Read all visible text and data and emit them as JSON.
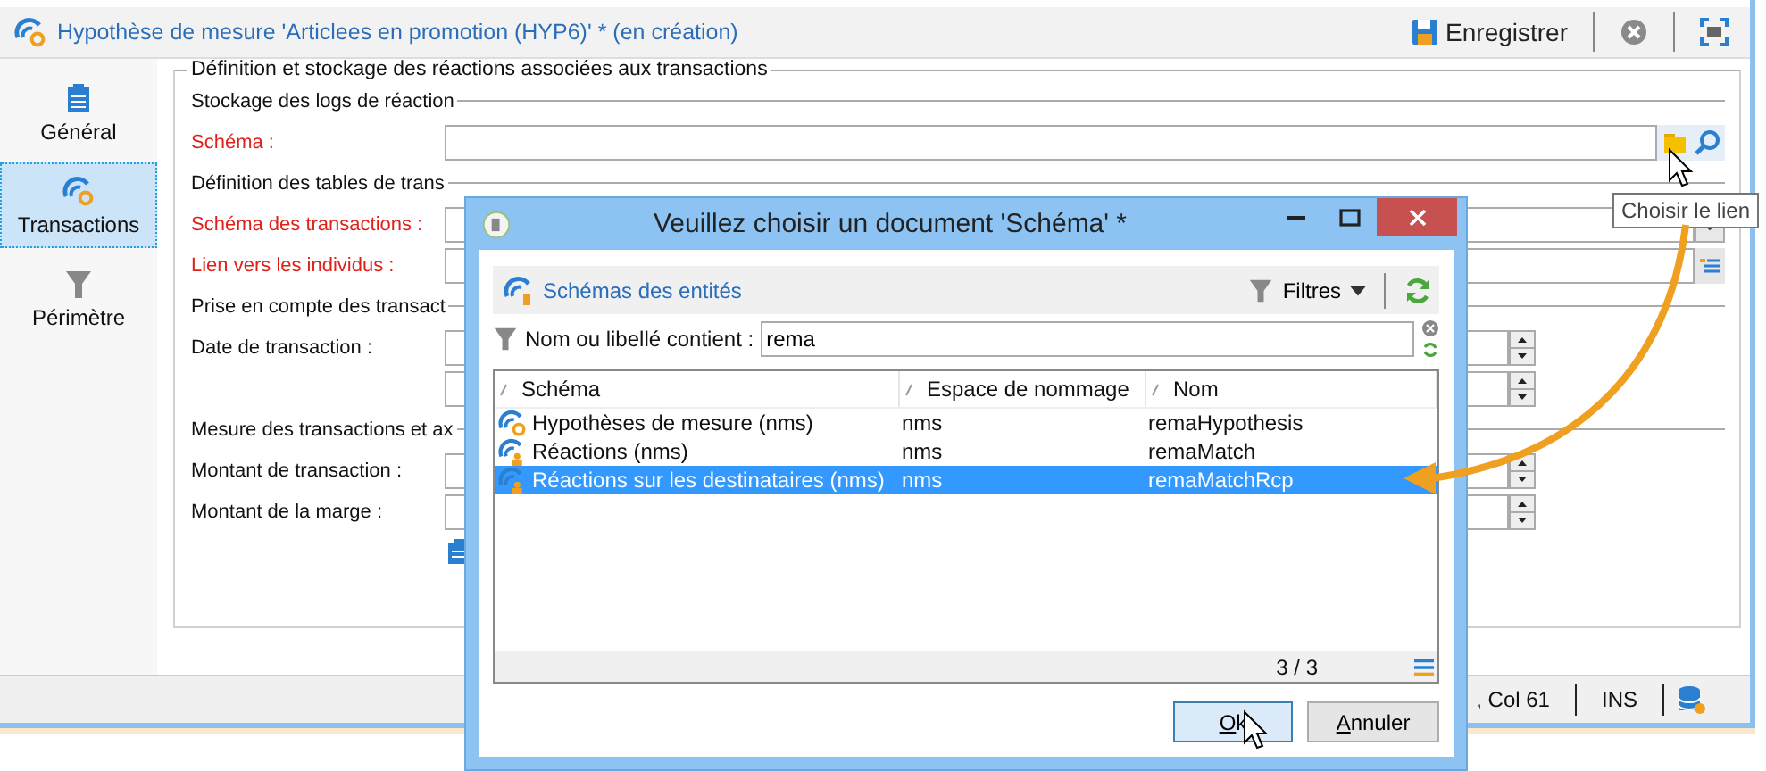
{
  "window": {
    "title": "Hypothèse de mesure 'Articlees en promotion (HYP6)' * (en création)",
    "save_label": "Enregistrer"
  },
  "sidebar": {
    "items": [
      {
        "kind": "general",
        "label": "Général",
        "selected": false
      },
      {
        "kind": "transactions",
        "label": "Transactions",
        "selected": true
      },
      {
        "kind": "perimeter",
        "label": "Périmètre",
        "selected": false
      }
    ]
  },
  "form": {
    "title": "Définition et stockage des réactions associées aux transactions",
    "rows": [
      {
        "kind": "section",
        "label": "Stockage des logs de réaction"
      },
      {
        "kind": "link",
        "label": "Schéma :",
        "required": true
      },
      {
        "kind": "section",
        "label": "Définition des tables de trans"
      },
      {
        "kind": "select",
        "label": "Schéma des transactions :",
        "required": true
      },
      {
        "kind": "edit",
        "label": "Lien vers les individus :",
        "required": true
      },
      {
        "kind": "section",
        "label": "Prise en compte des transact"
      },
      {
        "kind": "spin",
        "label": "Date de transaction :",
        "required": false
      },
      {
        "kind": "spin"
      },
      {
        "kind": "section",
        "label": "Mesure des transactions et ax"
      },
      {
        "kind": "spin",
        "label": "Montant de transaction :",
        "required": false
      },
      {
        "kind": "spin",
        "label": "Montant de la marge :",
        "required": false
      },
      {
        "kind": "tool"
      }
    ]
  },
  "tooltip": "Choisir le lien",
  "status_bar": {
    "position": ", Col 61",
    "mode": "INS"
  },
  "dialog": {
    "title": "Veuillez choisir un document 'Schéma' *",
    "panel_title": "Schémas des entités",
    "filters_label": "Filtres",
    "filter": {
      "label": "Nom ou libellé contient :",
      "value": "rema"
    },
    "table": {
      "columns": [
        "Schéma",
        "Espace de nommage",
        "Nom"
      ],
      "rows": [
        {
          "kind": "hypothesis",
          "cells": [
            "Hypothèses de mesure (nms)",
            "nms",
            "remaHypothesis"
          ],
          "selected": false
        },
        {
          "kind": "reaction",
          "cells": [
            "Réactions (nms)",
            "nms",
            "remaMatch"
          ],
          "selected": false
        },
        {
          "kind": "reaction",
          "cells": [
            "Réactions sur les destinataires (nms)",
            "nms",
            "remaMatchRcp"
          ],
          "selected": true
        }
      ]
    },
    "count": "3 / 3",
    "buttons": [
      {
        "label": "Ok",
        "default": true
      },
      {
        "label": "Annuler",
        "default": false
      }
    ]
  }
}
